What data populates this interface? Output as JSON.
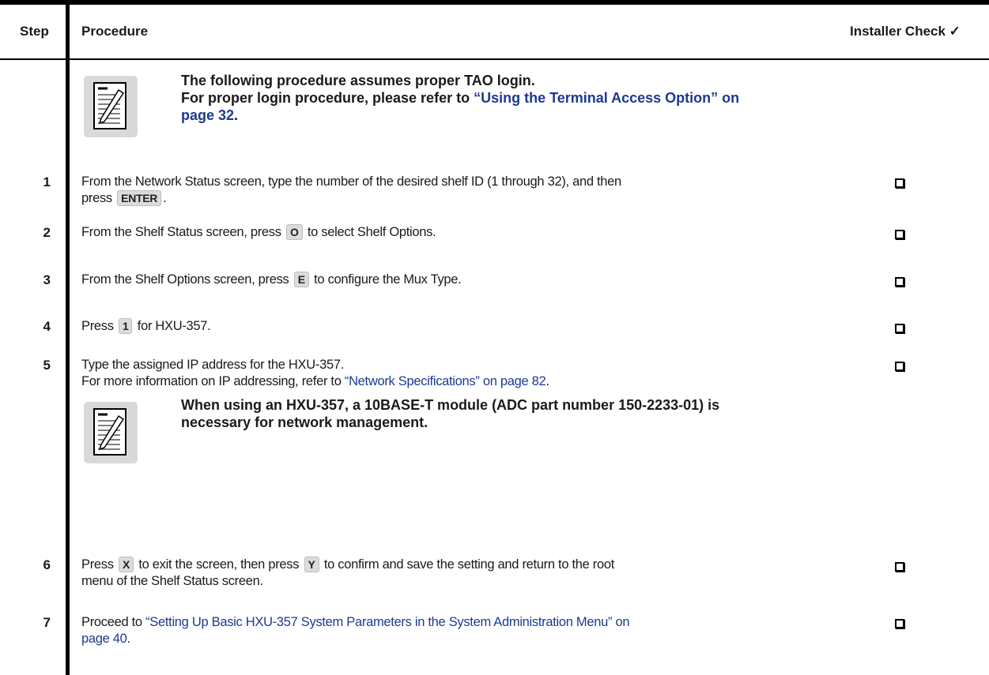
{
  "header": {
    "step": "Step",
    "procedure": "Procedure",
    "installer_check": "Installer Check ✓"
  },
  "note1": {
    "line1": "The following procedure assumes proper TAO login.",
    "line2_prefix": "For proper login procedure, please refer to ",
    "line2_link": "“Using the Terminal Access Option” on",
    "line3_link": "page 32",
    "line3_suffix": "."
  },
  "steps": [
    {
      "num": "1",
      "text_a": "From the Network Status screen, type the number of the desired shelf ID (1 through 32), and then",
      "text_b": "press",
      "key": "ENTER",
      "text_c": "."
    },
    {
      "num": "2",
      "text_a": "From the Shelf Status screen, press",
      "key": "O",
      "text_b": "to select Shelf Options."
    },
    {
      "num": "3",
      "text_a": "From the Shelf Options screen, press",
      "key": "E",
      "text_b": "to configure the Mux Type."
    },
    {
      "num": "4",
      "text_a": "Press",
      "key": "1",
      "text_b": "for HXU-357."
    },
    {
      "num": "5",
      "text_a": "Type the assigned IP address for the HXU-357.",
      "text_b": "For more information on IP addressing, refer to ",
      "link": "“Network Specifications” on page 82",
      "text_c": "."
    },
    {
      "num": "6",
      "text_a": "Press",
      "key1": "X",
      "text_b": "to exit the screen, then press",
      "key2": "Y",
      "text_c": "to confirm and save the setting and return to the root",
      "text_d": "menu of the Shelf Status screen."
    },
    {
      "num": "7",
      "text_a": "Proceed to ",
      "link_a": "“Setting Up Basic HXU-357 System Parameters in the System Administration Menu” on",
      "link_b": "page 40",
      "text_b": "."
    }
  ],
  "note2": {
    "line1": "When using an HXU-357, a 10BASE-T module (ADC part number 150-2233-01) is",
    "line2": "necessary for network management."
  },
  "icons": {
    "note": "note-pencil-icon",
    "check": "checkbox-icon"
  }
}
